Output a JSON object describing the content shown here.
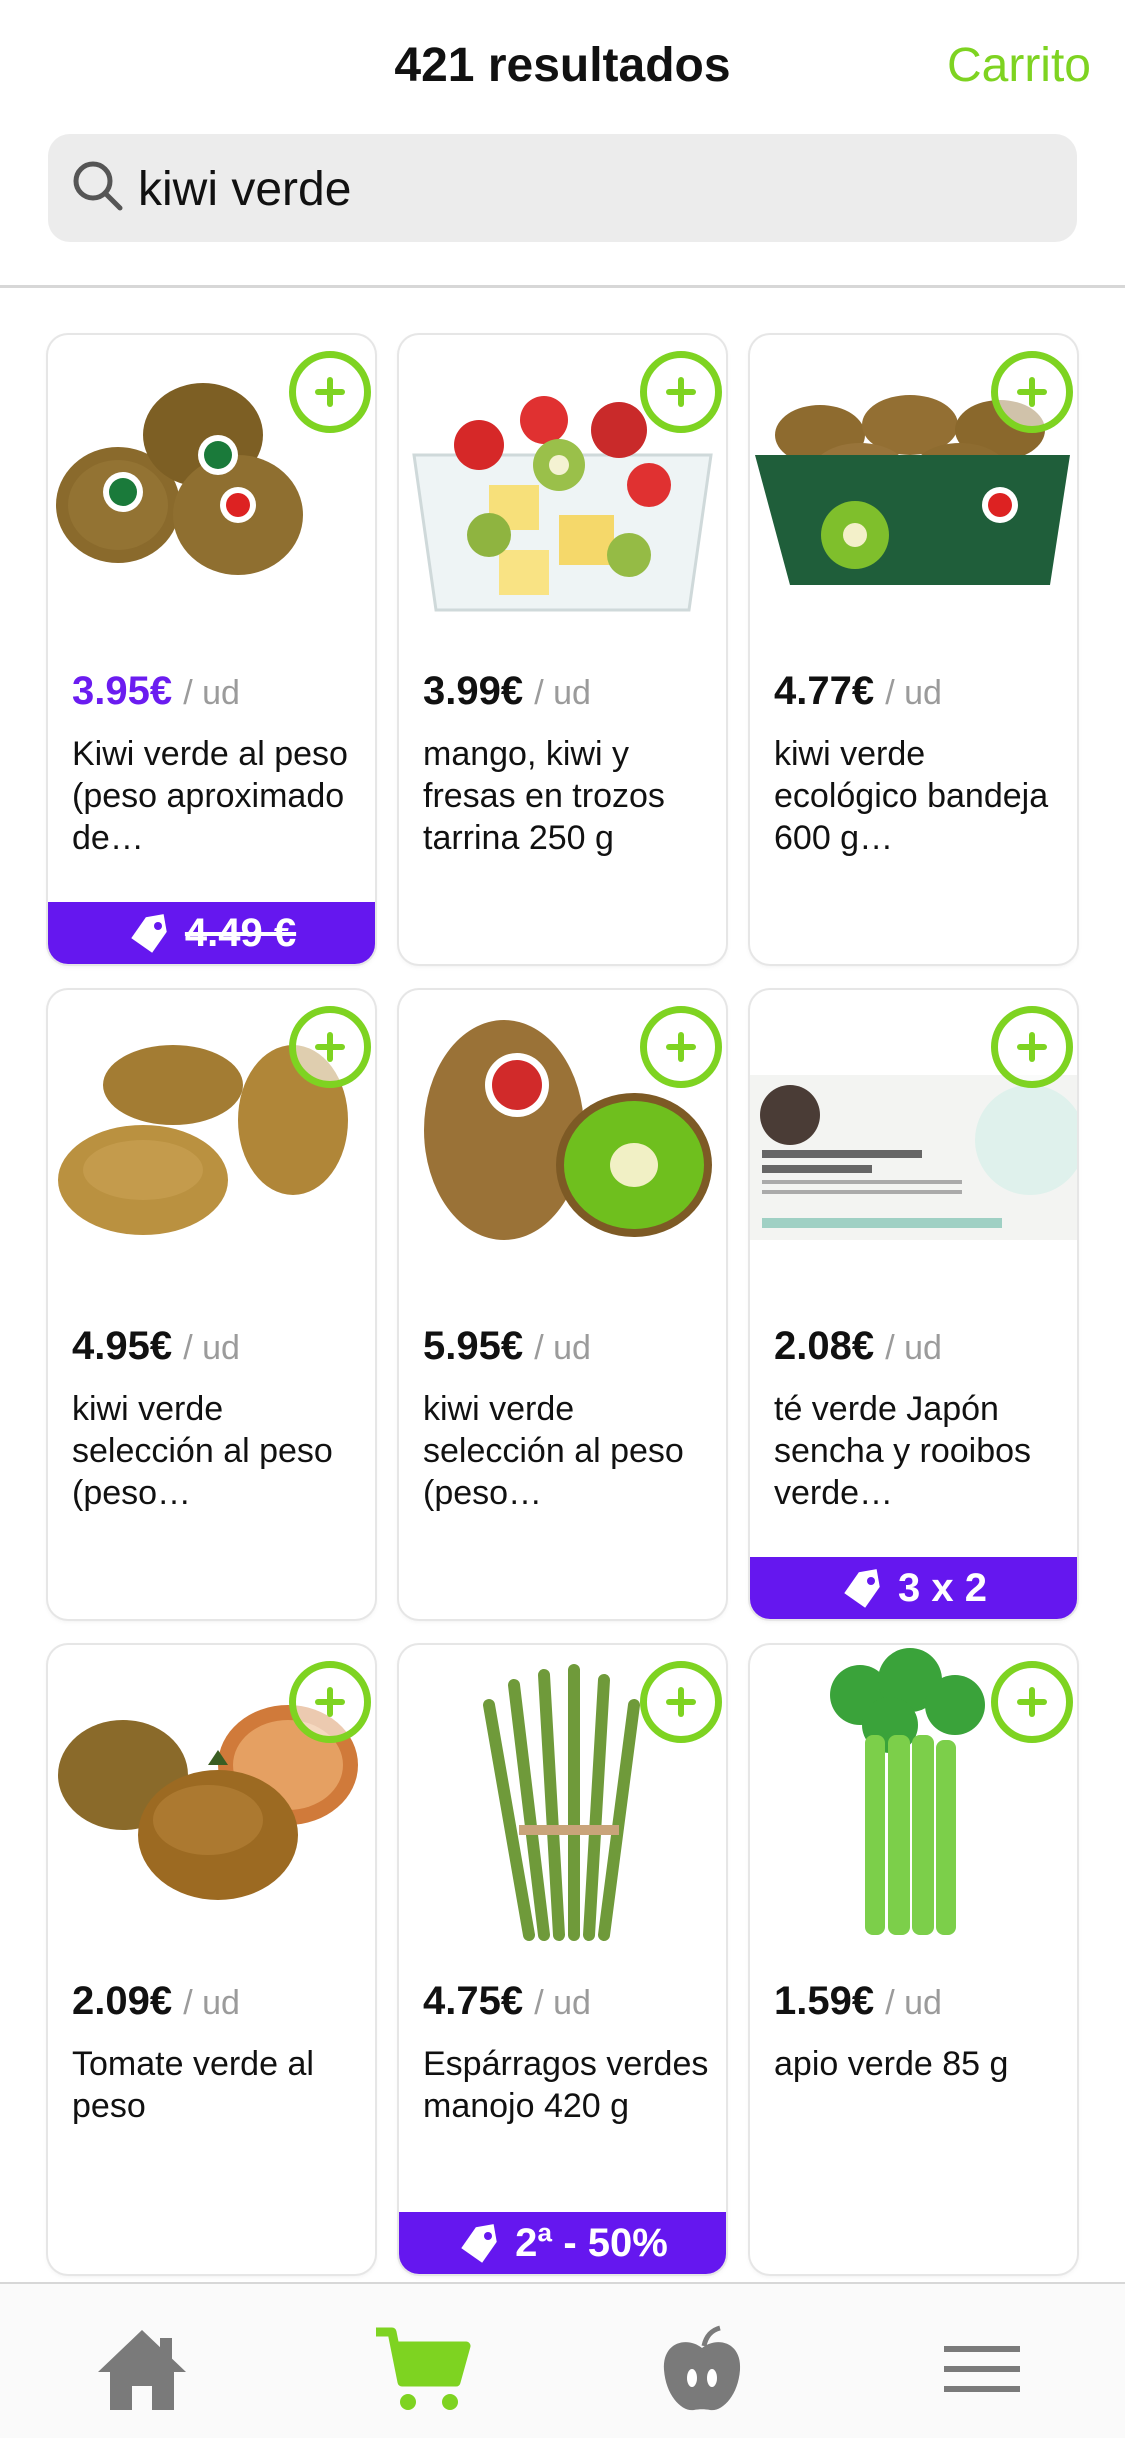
{
  "header": {
    "title": "421 resultados",
    "cart_link": "Carrito"
  },
  "search": {
    "value": "kiwi verde"
  },
  "colors": {
    "accent": "#7ed321",
    "promo": "#6517ef",
    "sale_price": "#6b1cf0"
  },
  "products": [
    {
      "price": "3.95€",
      "unit": "/ ud",
      "name": "Kiwi verde al peso (peso aproximado de…",
      "badge": "4.49 €",
      "badge_type": "strikethrough",
      "on_sale": true,
      "image": "kiwis-zespri"
    },
    {
      "price": "3.99€",
      "unit": "/ ud",
      "name": "mango, kiwi y fresas en trozos tarrina 250 g",
      "image": "fruit-tub"
    },
    {
      "price": "4.77€",
      "unit": "/ ud",
      "name": "kiwi verde ecológico bandeja 600 g…",
      "image": "kiwi-tray"
    },
    {
      "price": "4.95€",
      "unit": "/ ud",
      "name": "kiwi verde selección al peso (peso…",
      "image": "kiwis-three"
    },
    {
      "price": "5.95€",
      "unit": "/ ud",
      "name": "kiwi verde selección al peso (peso…",
      "image": "kiwi-halved"
    },
    {
      "price": "2.08€",
      "unit": "/ ud",
      "name": "té verde Japón sencha y rooibos verde…",
      "badge": "3 x 2",
      "badge_type": "promo",
      "image": "tea-box"
    },
    {
      "price": "2.09€",
      "unit": "/ ud",
      "name": "Tomate verde al peso",
      "image": "tomatoes"
    },
    {
      "price": "4.75€",
      "unit": "/ ud",
      "name": "Espárragos verdes manojo 420 g",
      "badge": "2ª - 50%",
      "badge_type": "promo",
      "image": "asparagus"
    },
    {
      "price": "1.59€",
      "unit": "/ ud",
      "name": "apio verde 85 g",
      "image": "celery"
    }
  ],
  "tabbar": [
    {
      "icon": "home-icon",
      "active": false
    },
    {
      "icon": "cart-icon",
      "active": true
    },
    {
      "icon": "apple-icon",
      "active": false
    },
    {
      "icon": "menu-icon",
      "active": false
    }
  ]
}
